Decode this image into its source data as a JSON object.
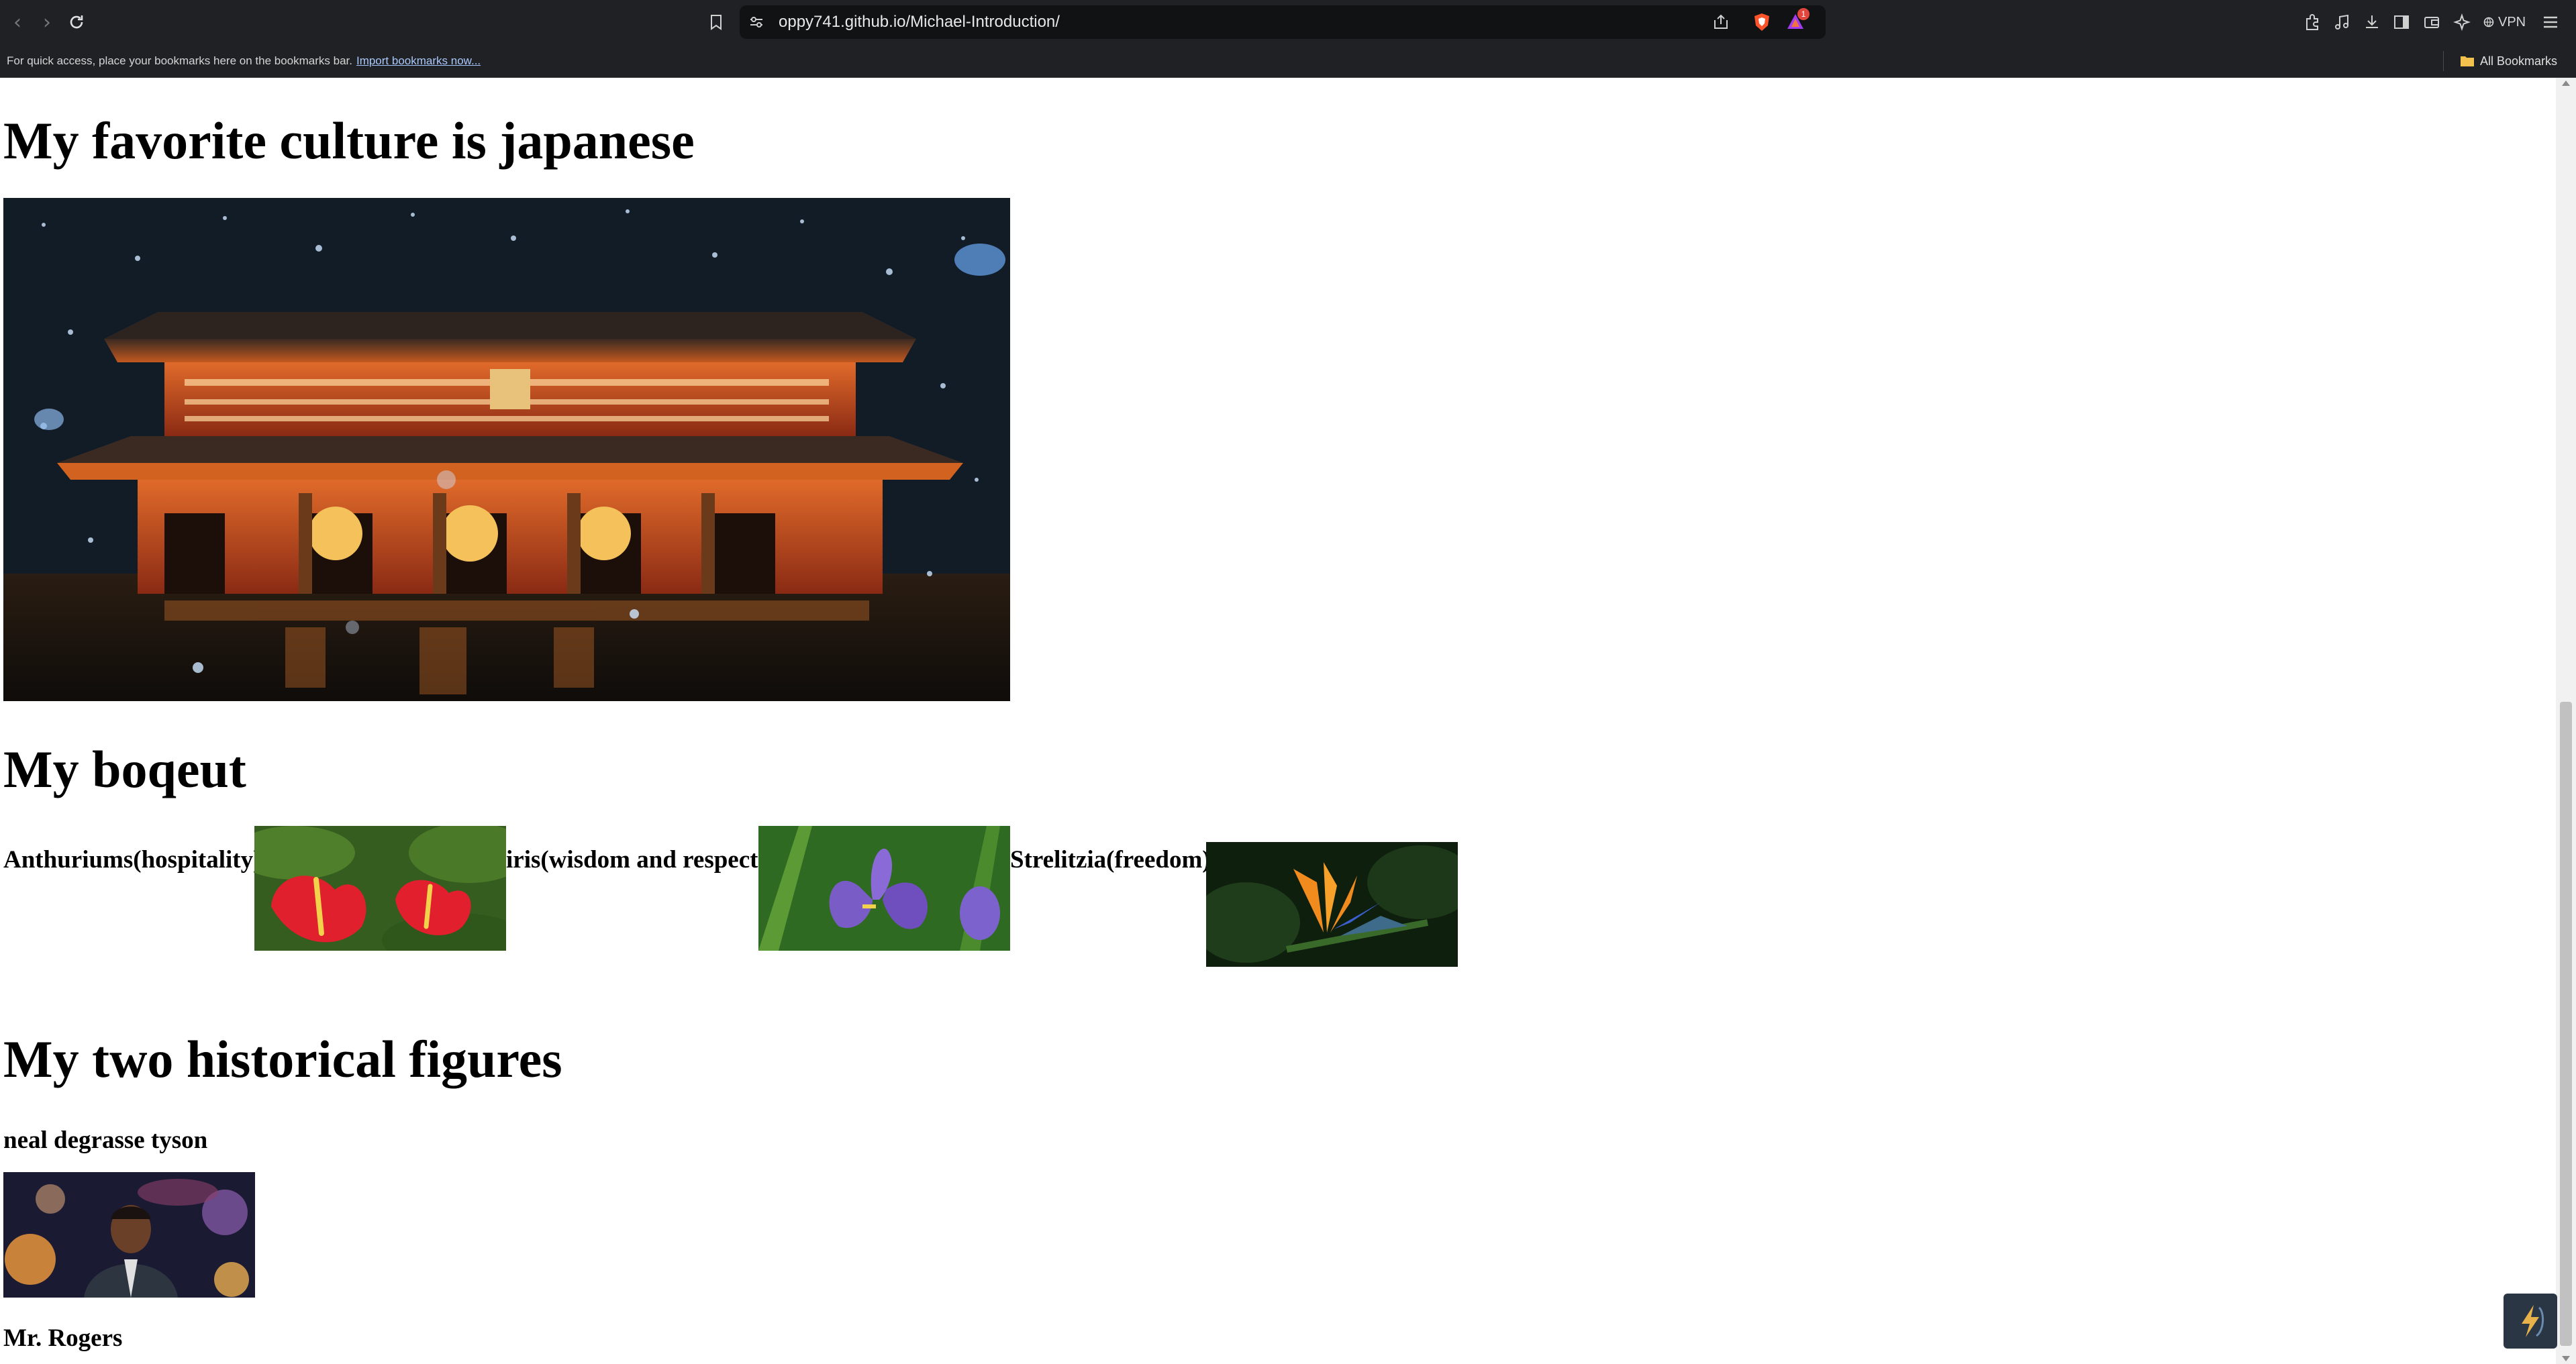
{
  "browser": {
    "url": "oppy741.github.io/Michael-Introduction/",
    "rewards_badge_count": "1",
    "vpn_label": "VPN",
    "bookmarks_bar": {
      "message": "For quick access, place your bookmarks here on the bookmarks bar.",
      "import_link": "Import bookmarks now...",
      "all_bookmarks": "All Bookmarks"
    }
  },
  "page": {
    "culture_heading": "My favorite culture is japanese",
    "bouquet_heading": "My boqeut",
    "flowers": [
      {
        "label": "Anthuriums(hospitality)"
      },
      {
        "label": "iris(wisdom and respect)"
      },
      {
        "label": "Strelitzia(freedom)"
      }
    ],
    "figures_heading": "My two historical figures",
    "figures": [
      {
        "name": "neal degrasse tyson"
      },
      {
        "name": "Mr. Rogers"
      }
    ]
  },
  "colors": {
    "chrome_bg": "#202124",
    "urlbar_bg": "#111214",
    "link": "#a8c7fa",
    "badge": "#e0463c"
  }
}
